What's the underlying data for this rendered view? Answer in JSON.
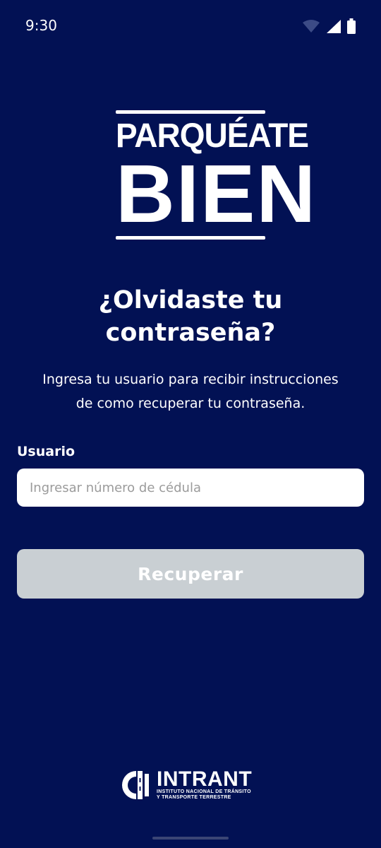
{
  "status_bar": {
    "time": "9:30"
  },
  "logo": {
    "line1": "PARQUÉATE",
    "line2": "BIEN"
  },
  "title": {
    "line1": "¿Olvidaste tu",
    "line2": "contraseña?"
  },
  "subtitle": {
    "line1": "Ingresa tu usuario para recibir instrucciones",
    "line2": "de como recuperar tu contraseña."
  },
  "form": {
    "user_label": "Usuario",
    "user_placeholder": "Ingresar número de cédula",
    "user_value": "",
    "submit_label": "Recuperar"
  },
  "footer": {
    "brand": "INTRANT",
    "sub_line1": "INSTITUTO NACIONAL DE TRÁNSITO",
    "sub_line2": "Y TRANSPORTE TERRESTRE"
  },
  "colors": {
    "background": "#021154",
    "button_disabled": "#c9cfd3",
    "text": "#ffffff"
  }
}
